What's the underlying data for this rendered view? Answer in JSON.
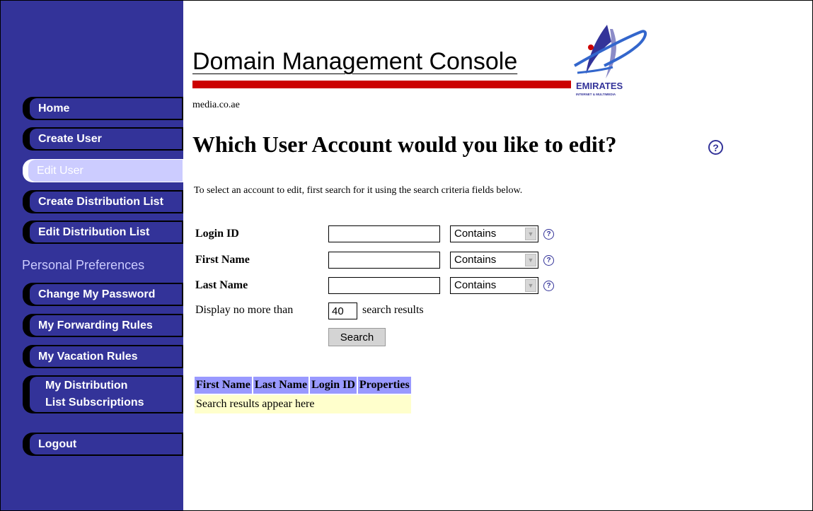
{
  "sidebar": {
    "items": [
      {
        "label": "Home"
      },
      {
        "label": "Create User"
      },
      {
        "label": "Edit User"
      },
      {
        "label": "Create Distribution List"
      },
      {
        "label": "Edit Distribution List"
      }
    ],
    "section_label": "Personal Preferences",
    "preference_items": [
      {
        "label": "Change My Password"
      },
      {
        "label": "My Forwarding Rules"
      },
      {
        "label": "My Vacation Rules"
      },
      {
        "line1": "My Distribution",
        "line2": "List Subscriptions"
      }
    ],
    "logout": "Logout",
    "active_item": "Edit User"
  },
  "header": {
    "console_title": "Domain Management Console",
    "logo_text": "EMIRATES",
    "logo_subtext": "INTERNET & MULTIMEDIA",
    "domain": "media.co.ae"
  },
  "main": {
    "title": "Which User Account would you like to edit?",
    "help_icon": "?",
    "instructions": "To select an account to edit, first search for it using the search criteria fields below."
  },
  "form": {
    "fields": [
      {
        "label": "Login ID",
        "value": "",
        "match": "Contains"
      },
      {
        "label": "First Name",
        "value": "",
        "match": "Contains"
      },
      {
        "label": "Last Name",
        "value": "",
        "match": "Contains"
      }
    ],
    "display_prefix": "Display no more than",
    "max_results": "40",
    "display_suffix": "search results",
    "search_button": "Search"
  },
  "results": {
    "columns": [
      "First Name",
      "Last Name",
      "Login ID",
      "Properties"
    ],
    "placeholder_row": "Search results appear here"
  },
  "colors": {
    "sidebar_bg": "#333399",
    "active_item_bg": "#ccccff",
    "header_bar": "#cc0000",
    "table_header": "#9999ff",
    "table_row": "#ffffcc"
  }
}
